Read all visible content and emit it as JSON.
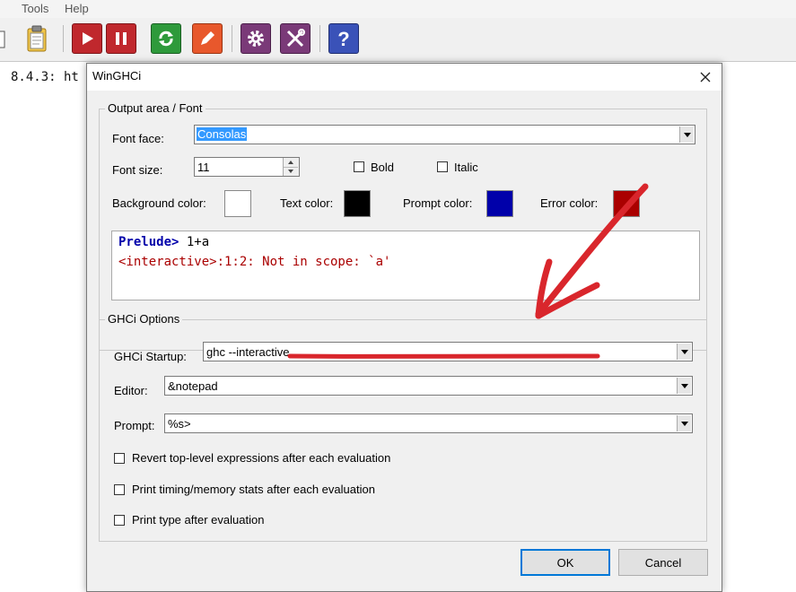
{
  "app": {
    "menu": [
      "Tools",
      "Help"
    ],
    "console_text": "8.4.3: ht"
  },
  "dialog": {
    "title": "WinGHCi",
    "font_group": {
      "legend": "Output area / Font",
      "font_face_label": "Font face:",
      "font_face_value": "Consolas",
      "font_size_label": "Font size:",
      "font_size_value": "11",
      "bold_label": "Bold",
      "italic_label": "Italic",
      "background_color_label": "Background color:",
      "text_color_label": "Text color:",
      "prompt_color_label": "Prompt color:",
      "error_color_label": "Error color:",
      "colors": {
        "background": "#ffffff",
        "text": "#000000",
        "prompt": "#0000aa",
        "error": "#aa0000"
      },
      "preview": {
        "prompt": "Prelude>",
        "input": " 1+a",
        "error": "<interactive>:1:2: Not in scope: `a'"
      }
    },
    "ghci_group": {
      "legend": "GHCi Options",
      "startup_label": "GHCi Startup:",
      "startup_value": "ghc --interactive",
      "editor_label": "Editor:",
      "editor_value": "&notepad",
      "prompt_label": "Prompt:",
      "prompt_value": "%s>",
      "revert_label": "Revert top-level expressions after each evaluation",
      "timing_label": "Print timing/memory stats after each evaluation",
      "type_label": "Print type after evaluation"
    },
    "ok_label": "OK",
    "cancel_label": "Cancel"
  },
  "icons": [
    "clipboard-icon",
    "run-icon",
    "pause-icon",
    "reload-icon",
    "edit-icon",
    "settings-icon",
    "tools-icon",
    "help-icon"
  ],
  "annotation_color": "#d9262c"
}
